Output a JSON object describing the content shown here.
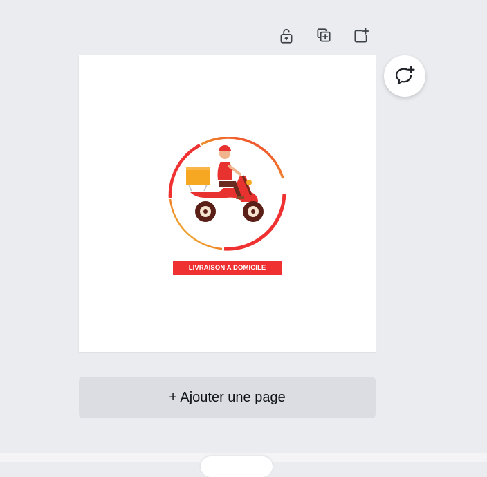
{
  "toolbar": {
    "icons": [
      "unlock-icon",
      "duplicate-page-icon",
      "add-page-icon"
    ]
  },
  "comment": {
    "icon": "add-comment-icon"
  },
  "design": {
    "logo_label": "LIVRAISON A DOMICILE",
    "colors": {
      "ring_red": "#ef3131",
      "ring_yellow": "#e6d83a",
      "box_orange": "#f7a823",
      "scooter_red": "#e8322f"
    }
  },
  "add_page": {
    "label": "+ Ajouter une page"
  },
  "colors": {
    "background": "#ebecf0",
    "button": "#dcdde2",
    "icon": "#3d4248"
  }
}
